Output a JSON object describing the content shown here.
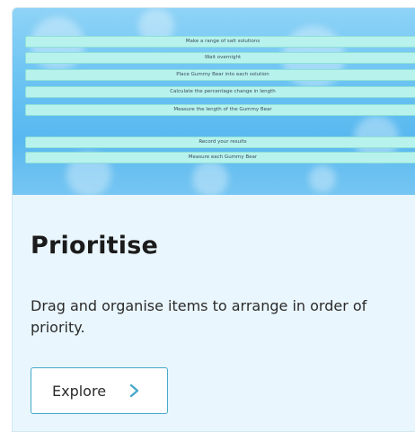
{
  "card": {
    "title": "Prioritise",
    "description": "Drag and organise items to arrange in order of priority.",
    "explore_label": "Explore",
    "chevron_icon": "chevron-right-icon",
    "accent_color": "#46a9c9",
    "background_color": "#e9f6fd"
  },
  "hero": {
    "items": [
      "Make a range of salt solutions",
      "Wait overnight",
      "Place Gummy Bear into each solution",
      "Calculate the percentage change in length",
      "Measure the length of the Gummy Bear",
      "Record your results",
      "Measure each Gummy Bear"
    ]
  }
}
